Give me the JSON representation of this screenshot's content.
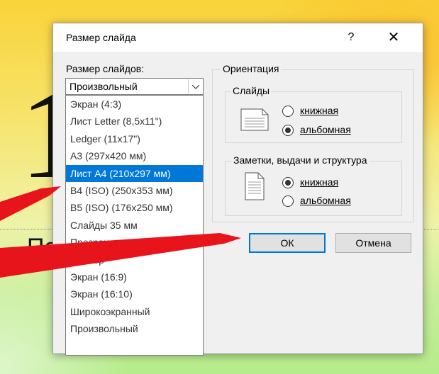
{
  "background": {
    "digit": "1",
    "subtitle": "По"
  },
  "dialog": {
    "title": "Размер слайда",
    "help_label": "?",
    "close_label": "✕",
    "size_label": "Размер слайдов:",
    "size_selected": "Произвольный",
    "dropdown_items": [
      "Экран (4:3)",
      "Лист Letter (8,5x11\")",
      "Ledger (11x17\")",
      "А3 (297x420 мм)",
      "Лист А4 (210x297 мм)",
      "B4 (ISO) (250x353 мм)",
      "B5 (ISO) (176x250 мм)",
      "Слайды 35 мм",
      "Прозрачка",
      "Баннер",
      "Экран (16:9)",
      "Экран (16:10)",
      "Широкоэкранный",
      "Произвольный"
    ],
    "selected_item_index": 4,
    "orientation": {
      "title": "Ориентация",
      "slides": {
        "title": "Слайды",
        "portrait_label": "книжная",
        "landscape_label": "альбомная",
        "selected": "landscape"
      },
      "notes": {
        "title": "Заметки, выдачи и структура",
        "portrait_label": "книжная",
        "landscape_label": "альбомная",
        "selected": "portrait"
      }
    },
    "ok_label": "ОК",
    "cancel_label": "Отмена"
  },
  "colors": {
    "accent": "#0078d7",
    "arrow": "#e8141c"
  }
}
